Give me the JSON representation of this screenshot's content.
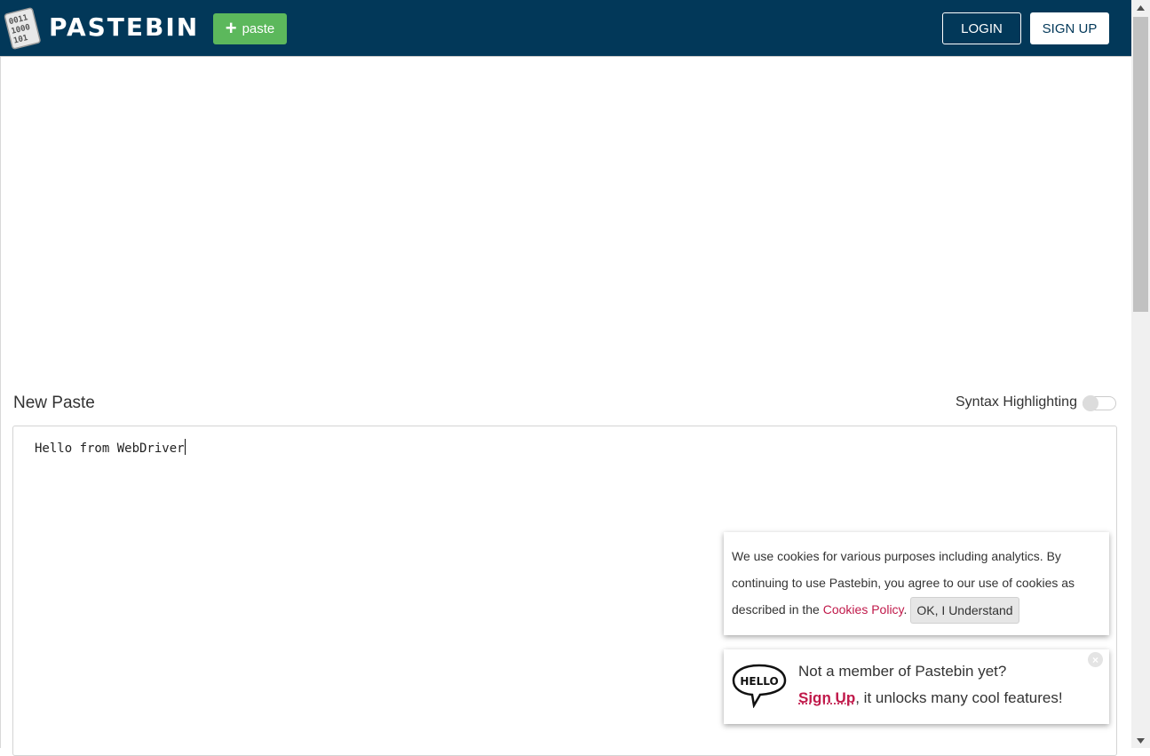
{
  "header": {
    "logo_text": "PASTEBIN",
    "logo_icon": "binary-paper-icon",
    "paste_button_label": "paste",
    "login_label": "LOGIN",
    "signup_label": "SIGN UP"
  },
  "editor": {
    "title": "New Paste",
    "syntax_label": "Syntax Highlighting",
    "syntax_enabled": false,
    "content": "Hello from WebDriver"
  },
  "cookie_notice": {
    "text_before": "We use cookies for various purposes including analytics. By continuing to use Pastebin, you agree to our use of cookies as described in the ",
    "link_text": "Cookies Policy",
    "text_after": ".",
    "ok_label": "OK, I Understand"
  },
  "member_notice": {
    "line1": "Not a member of Pastebin yet?",
    "signup_link": "Sign Up",
    "line2_rest": ", it unlocks many cool features!",
    "close_symbol": "×"
  },
  "colors": {
    "header_bg": "#023859",
    "paste_button_bg": "#5cb85c",
    "link_color": "#c0194a"
  }
}
